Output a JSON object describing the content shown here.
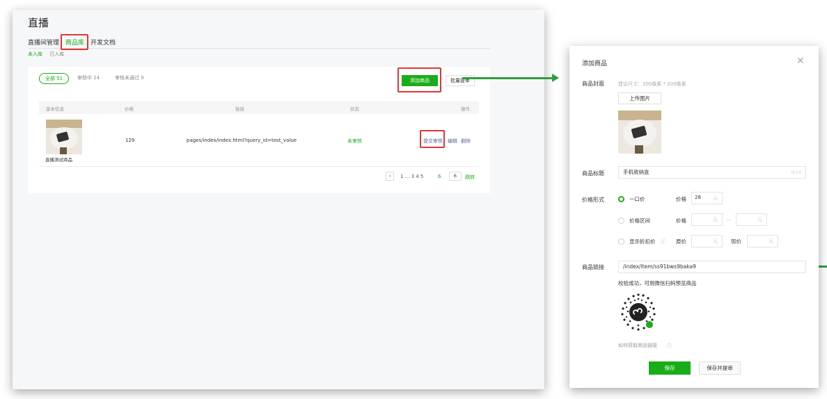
{
  "page": {
    "title": "直播",
    "tabs": [
      "直播间管理",
      "商品库",
      "开发文档"
    ],
    "subtabs": [
      "未入库",
      "已入库"
    ]
  },
  "filters": [
    "全部 51",
    "审核中 14",
    "审核未通过 0"
  ],
  "buttons": {
    "add": "添加商品",
    "batch": "批量提审"
  },
  "table": {
    "headers": [
      "基本信息",
      "价格",
      "链接",
      "状态",
      "操作"
    ],
    "row": {
      "name": "直播测试商品",
      "price": "129",
      "link": "pages/index/index.html?query_id=test_value",
      "status": "未审核",
      "ops": [
        "提交审核",
        "编辑",
        "删除"
      ]
    }
  },
  "pagination": {
    "prev": "‹",
    "pages": "1 ... 3 4 5",
    "current": "6",
    "jump_value": "6",
    "jump_label": "跳转"
  },
  "dialog": {
    "title": "添加商品",
    "close_icon": "close-icon",
    "cover_label": "商品封面",
    "cover_hint": "建议尺寸：200像素 * 200像素",
    "upload_label": "上传图片",
    "title_label": "商品标题",
    "title_value": "手机收纳盒",
    "title_counter": "0/14",
    "price_label": "价格形式",
    "price_options": [
      "一口价",
      "价格区间",
      "显示折扣价"
    ],
    "price_word": "价格",
    "orig_price_word": "原价",
    "now_price_word": "现价",
    "price_value": "28",
    "unit": "元",
    "dash": "—",
    "link_label": "商品链接",
    "link_value": "/index/item/ss91bws9baka9",
    "verify_text": "校验成功，可用微信扫码预览商品",
    "how_to": "如何获取商品链接",
    "save": "保存",
    "save_submit": "保存并提审"
  },
  "colors": {
    "accent": "#1aad19",
    "highlight": "#e53333",
    "arrow": "#2f9e3d",
    "link": "#576b95"
  }
}
